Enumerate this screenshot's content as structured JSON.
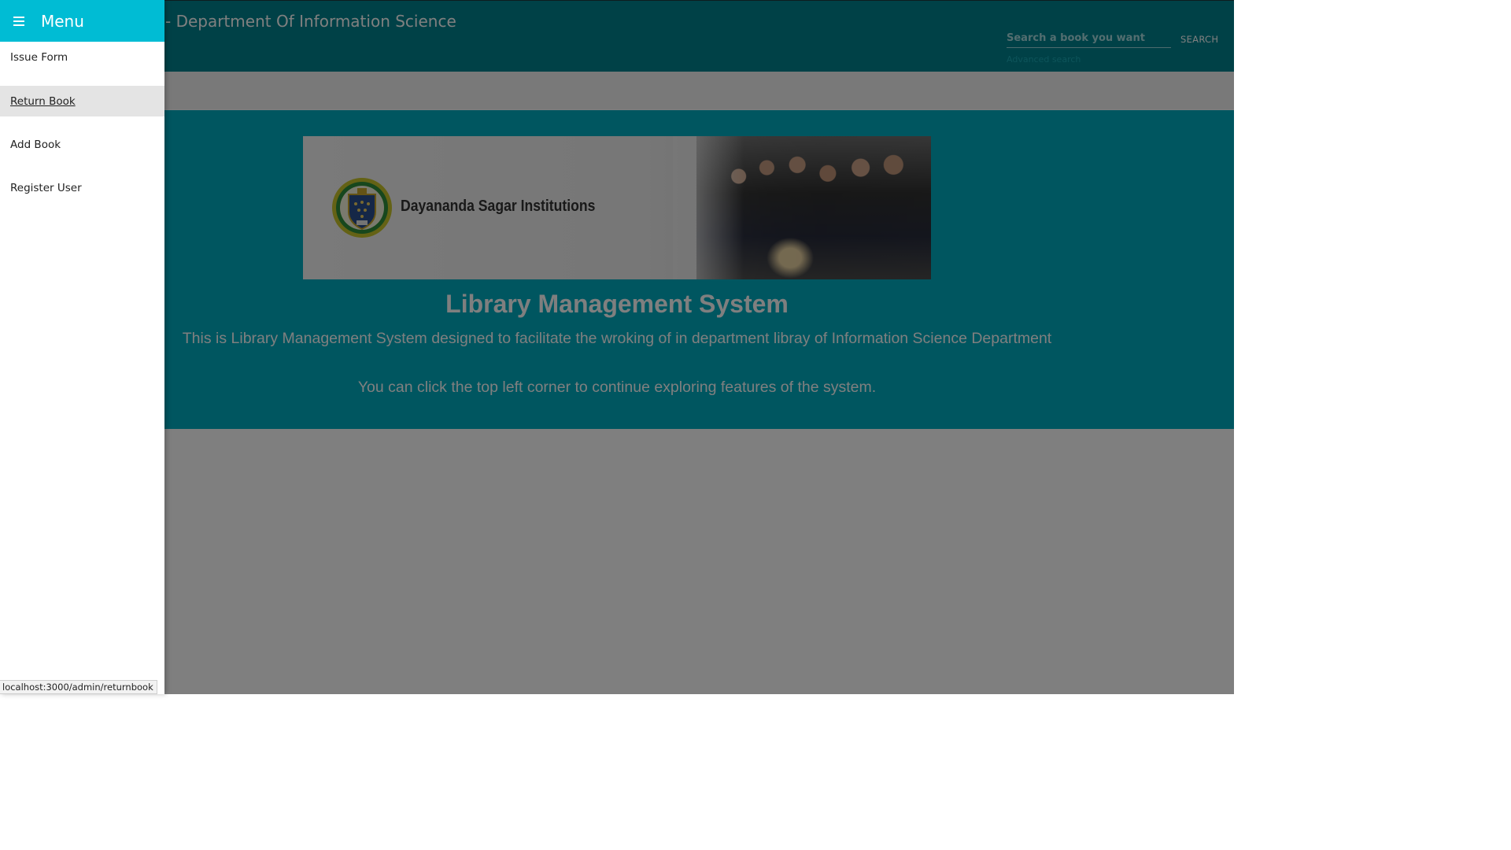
{
  "app_bar": {
    "title": "- Department Of Information Science",
    "search": {
      "placeholder": "Search a book you want",
      "button_label": "SEARCH",
      "advanced_link": "Advanced search"
    }
  },
  "hero": {
    "banner_brand": "Dayananda Sagar Institutions",
    "title": "Library Management System",
    "description": "This is Library Management System designed to facilitate the wroking of in department libray of Information Science Department",
    "hint": "You can click the top left corner to continue exploring features of the system."
  },
  "drawer": {
    "title": "Menu",
    "items": [
      {
        "label": "Issue Form"
      },
      {
        "label": "Return Book"
      },
      {
        "label": "Add Book"
      },
      {
        "label": "Register User"
      }
    ]
  },
  "status_bar": {
    "url": "localhost:3000/admin/returnbook"
  },
  "colors": {
    "app_bar": "#00838f",
    "hero": "#00acc1",
    "drawer_header": "#00bcd4",
    "scrim": "rgba(0,0,0,0.5)"
  }
}
